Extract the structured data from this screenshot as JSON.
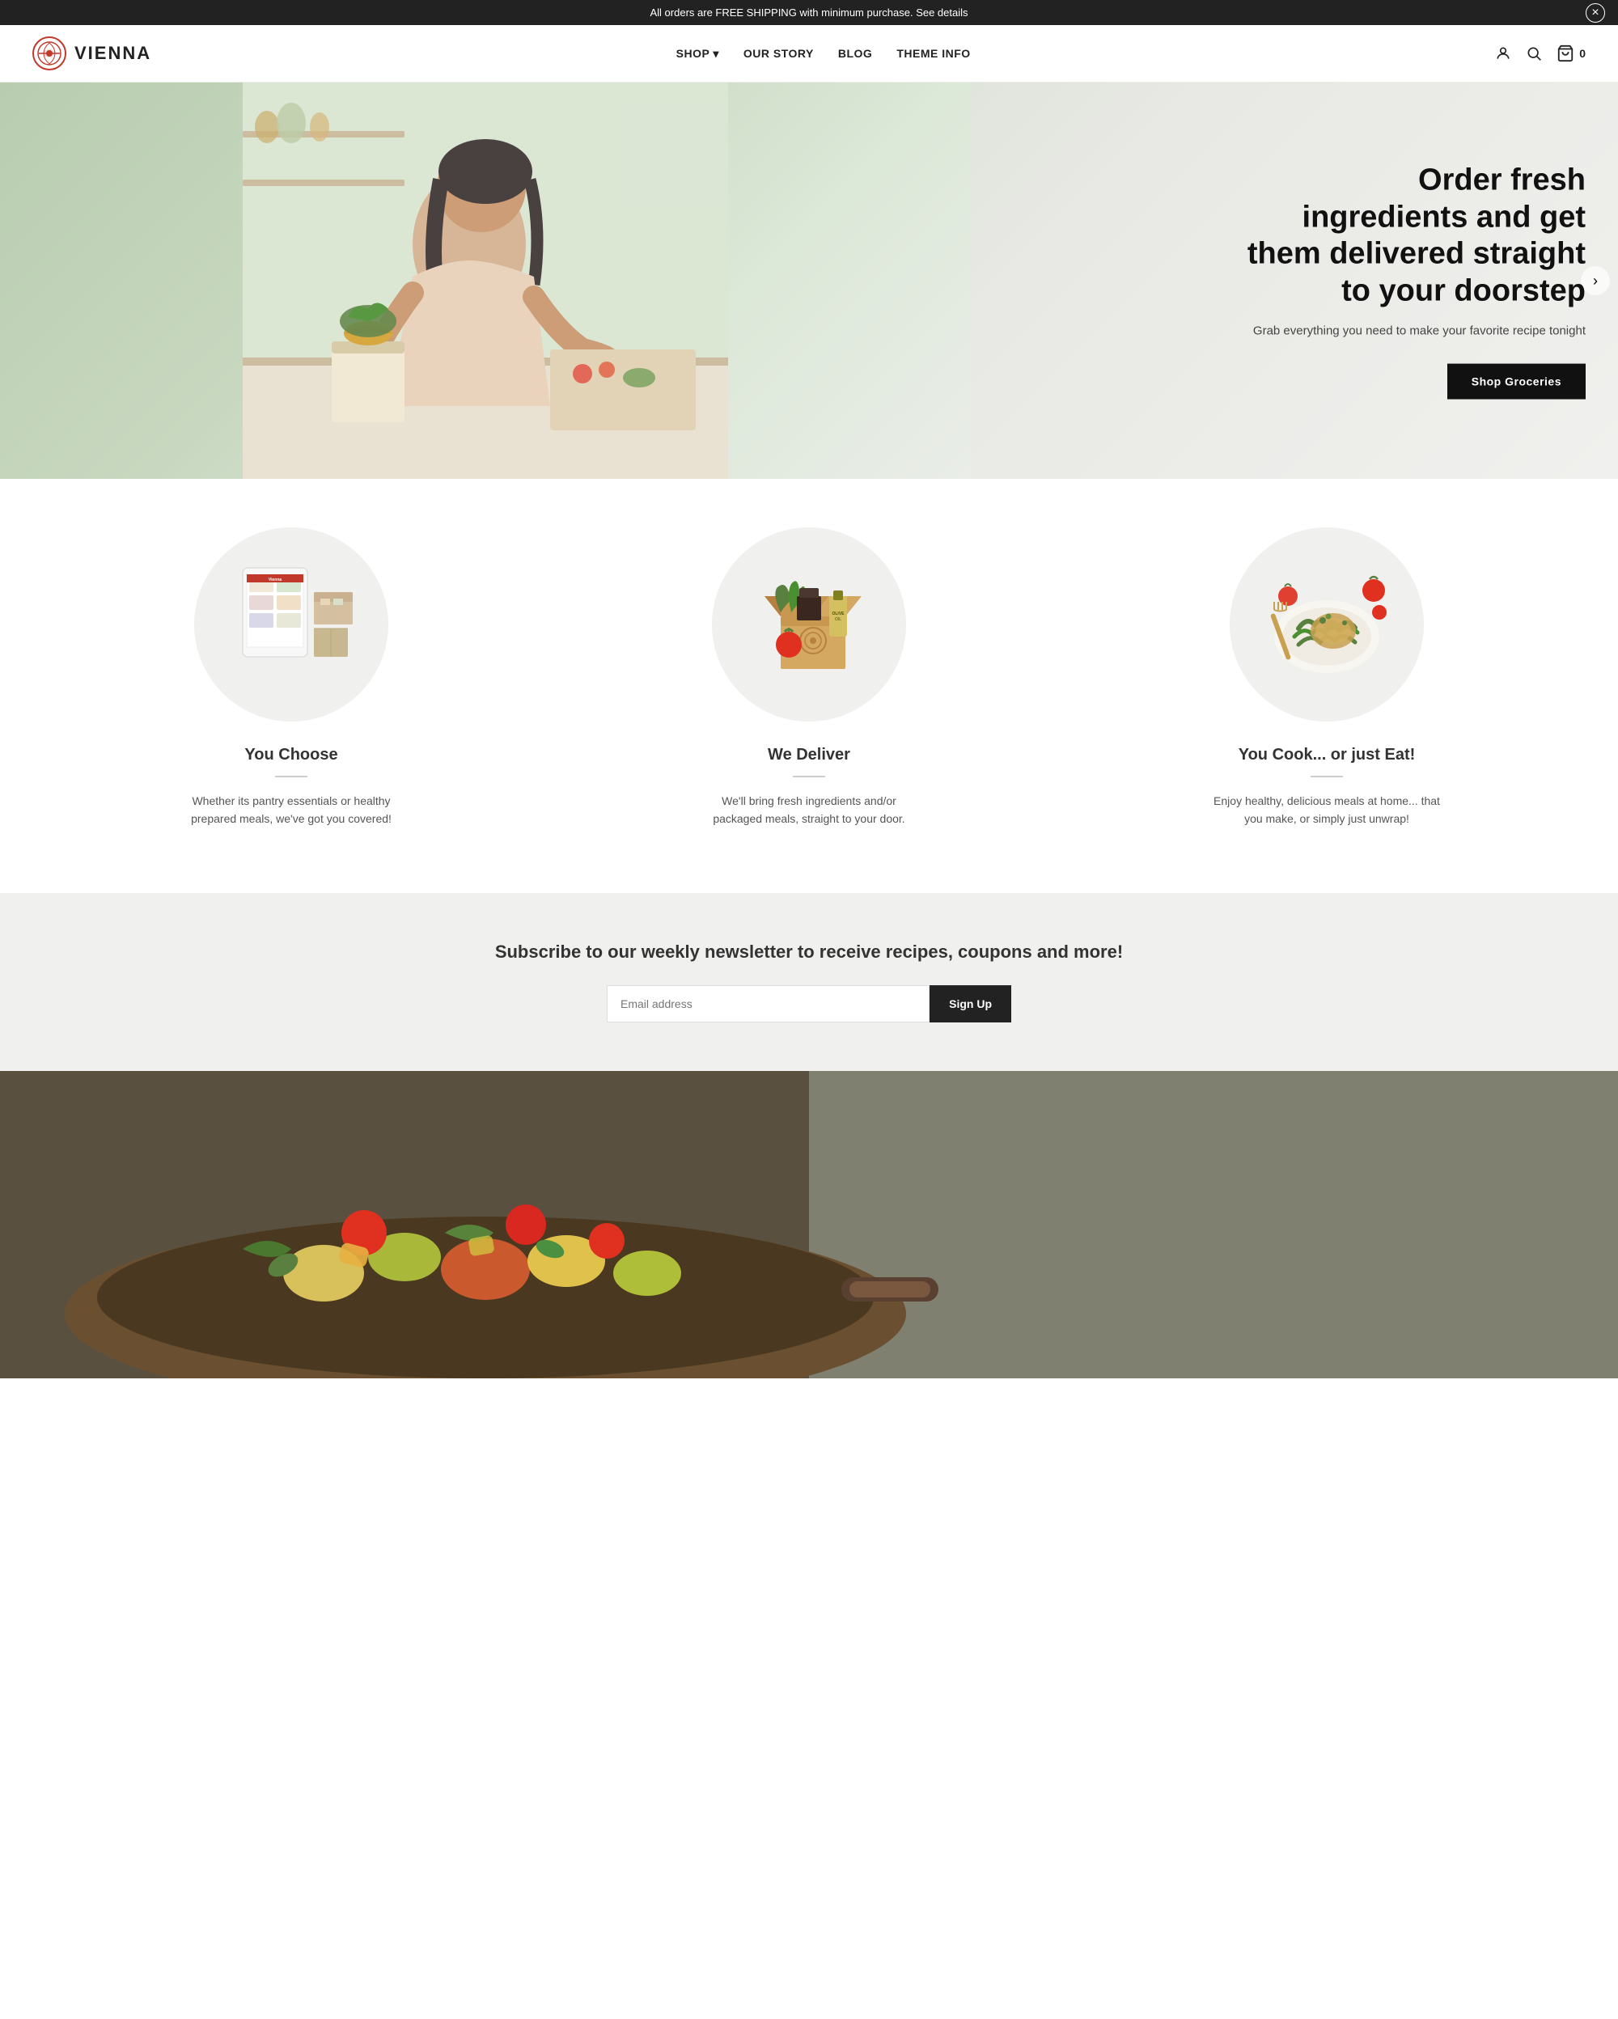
{
  "announcement": {
    "text": "All orders are FREE SHIPPING with minimum purchase. See details",
    "close_label": "×"
  },
  "header": {
    "logo_text": "VIENNA",
    "nav": [
      {
        "label": "SHOP",
        "has_dropdown": true
      },
      {
        "label": "OUR STORY"
      },
      {
        "label": "BLOG"
      },
      {
        "label": "THEME INFO"
      }
    ],
    "cart_label": "0"
  },
  "hero": {
    "title": "Order fresh ingredients and get them delivered straight to your doorstep",
    "subtitle": "Grab everything you need to make your favorite recipe tonight",
    "cta_label": "Shop Groceries"
  },
  "features": [
    {
      "title": "You Choose",
      "description": "Whether its pantry essentials or healthy prepared meals, we've got you covered!"
    },
    {
      "title": "We Deliver",
      "description": "We'll bring fresh ingredients and/or packaged meals, straight to your door."
    },
    {
      "title": "You Cook... or just Eat!",
      "description": "Enjoy healthy, delicious meals at home... that you make, or simply just unwrap!"
    }
  ],
  "newsletter": {
    "title": "Subscribe to our weekly newsletter to receive recipes, coupons and more!",
    "placeholder": "Email address",
    "button_label": "Sign Up"
  }
}
